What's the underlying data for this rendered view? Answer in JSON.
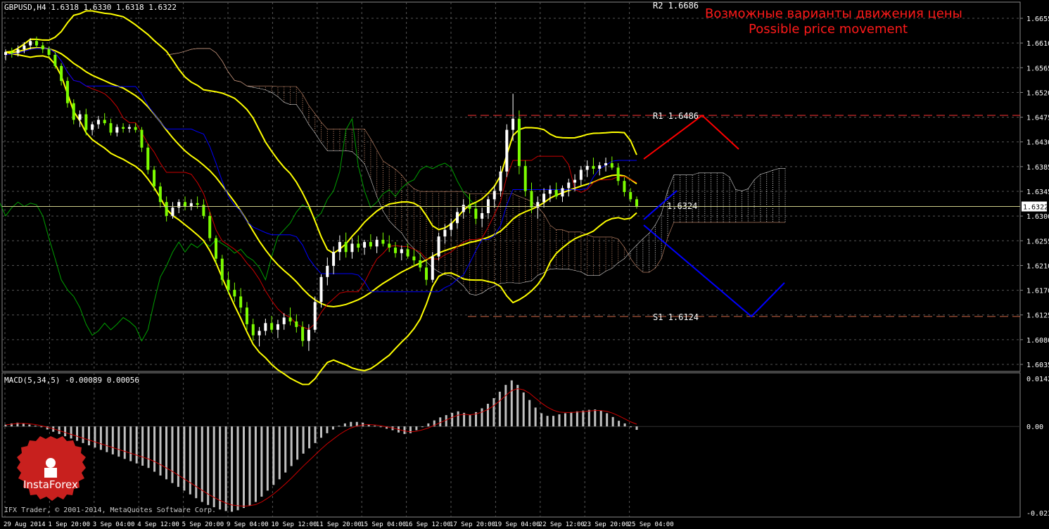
{
  "symbol_header": "GBPUSD,H4  1.6318 1.6330 1.6318 1.6322",
  "annotation_ru": "Возможные варианты движения цены",
  "annotation_en": "Possible price movement",
  "macd_header": "MACD(5,34,5) -0.00089 0.00056",
  "copyright": "IFX Trader, © 2001-2014, MetaQuotes Software Corp.",
  "logo_text": "InstaForex",
  "colors": {
    "bull": "#ffffff",
    "bear": "#7cfc00",
    "bollinger": "#ffff00",
    "tenkan": "#cc0000",
    "kijun": "#0000ff",
    "chikou": "#00a000",
    "kumo": "#ffffff",
    "macd_hist": "#c0c0c0",
    "macd_signal": "#cc0000",
    "resistance": "#ff0000",
    "support": "#0000ff",
    "annotation": "#ff1a1a",
    "grid": "#555555"
  },
  "levels": [
    {
      "name": "R2",
      "value": 1.6686,
      "label": "R2 1.6686"
    },
    {
      "name": "R1",
      "value": 1.6486,
      "label": "R1 1.6486"
    },
    {
      "name": "pivot",
      "value": 1.6324,
      "label": "1.6324"
    },
    {
      "name": "S1",
      "value": 1.6124,
      "label": "S1 1.6124"
    }
  ],
  "current_price": "1.6322",
  "chart_data": [
    {
      "type": "candlestick",
      "title": "GBPUSD,H4",
      "x_ticks": [
        "29 Aug 2014",
        "1 Sep 20:00",
        "3 Sep 04:00",
        "4 Sep 12:00",
        "5 Sep 20:00",
        "9 Sep 04:00",
        "10 Sep 12:00",
        "11 Sep 20:00",
        "15 Sep 04:00",
        "16 Sep 12:00",
        "17 Sep 20:00",
        "19 Sep 04:00",
        "22 Sep 12:00",
        "23 Sep 20:00",
        "25 Sep 04:00"
      ],
      "y_ticks": [
        "1.6655",
        "1.6610",
        "1.6565",
        "1.6520",
        "1.6475",
        "1.6430",
        "1.6385",
        "1.6345",
        "1.6300",
        "1.6255",
        "1.6210",
        "1.6170",
        "1.6125",
        "1.6080",
        "1.6035"
      ],
      "ylim": [
        1.6025,
        1.669
      ],
      "candles": [
        [
          1.6595,
          1.6605,
          1.6585,
          1.66
        ],
        [
          1.66,
          1.6608,
          1.659,
          1.6598
        ],
        [
          1.6598,
          1.6612,
          1.6592,
          1.6605
        ],
        [
          1.6605,
          1.6618,
          1.6598,
          1.6612
        ],
        [
          1.6612,
          1.6625,
          1.6605,
          1.662
        ],
        [
          1.662,
          1.6628,
          1.6608,
          1.6612
        ],
        [
          1.6612,
          1.6618,
          1.6598,
          1.6605
        ],
        [
          1.6605,
          1.661,
          1.659,
          1.6595
        ],
        [
          1.6595,
          1.66,
          1.657,
          1.6575
        ],
        [
          1.6575,
          1.658,
          1.654,
          1.6548
        ],
        [
          1.6548,
          1.6555,
          1.65,
          1.6508
        ],
        [
          1.6508,
          1.6515,
          1.647,
          1.6478
        ],
        [
          1.6478,
          1.6495,
          1.6465,
          1.6488
        ],
        [
          1.6488,
          1.6498,
          1.645,
          1.646
        ],
        [
          1.646,
          1.6475,
          1.645,
          1.647
        ],
        [
          1.647,
          1.6485,
          1.6462,
          1.6478
        ],
        [
          1.6478,
          1.649,
          1.6468,
          1.6472
        ],
        [
          1.6472,
          1.648,
          1.645,
          1.6455
        ],
        [
          1.6455,
          1.647,
          1.6448,
          1.6465
        ],
        [
          1.6465,
          1.6472,
          1.6455,
          1.6462
        ],
        [
          1.6462,
          1.647,
          1.6455,
          1.6465
        ],
        [
          1.6465,
          1.6472,
          1.6455,
          1.646
        ],
        [
          1.646,
          1.6465,
          1.642,
          1.6428
        ],
        [
          1.6428,
          1.6435,
          1.638,
          1.6388
        ],
        [
          1.6388,
          1.6395,
          1.635,
          1.6358
        ],
        [
          1.6358,
          1.6365,
          1.632,
          1.633
        ],
        [
          1.633,
          1.634,
          1.6295,
          1.6305
        ],
        [
          1.6305,
          1.633,
          1.63,
          1.632
        ],
        [
          1.632,
          1.6335,
          1.631,
          1.633
        ],
        [
          1.633,
          1.634,
          1.6315,
          1.6322
        ],
        [
          1.6322,
          1.6335,
          1.6315,
          1.6328
        ],
        [
          1.6328,
          1.634,
          1.6318,
          1.6325
        ],
        [
          1.6325,
          1.6335,
          1.63,
          1.6305
        ],
        [
          1.6305,
          1.6312,
          1.626,
          1.6265
        ],
        [
          1.6265,
          1.627,
          1.622,
          1.6228
        ],
        [
          1.6228,
          1.6235,
          1.618,
          1.619
        ],
        [
          1.619,
          1.6205,
          1.6165,
          1.6172
        ],
        [
          1.6172,
          1.6185,
          1.615,
          1.616
        ],
        [
          1.616,
          1.6175,
          1.613,
          1.614
        ],
        [
          1.614,
          1.615,
          1.61,
          1.611
        ],
        [
          1.611,
          1.612,
          1.608,
          1.609
        ],
        [
          1.609,
          1.6105,
          1.607,
          1.6098
        ],
        [
          1.6098,
          1.612,
          1.609,
          1.6112
        ],
        [
          1.6112,
          1.6125,
          1.6095,
          1.61
        ],
        [
          1.61,
          1.6118,
          1.6085,
          1.611
        ],
        [
          1.611,
          1.613,
          1.61,
          1.6122
        ],
        [
          1.6122,
          1.614,
          1.6108,
          1.6115
        ],
        [
          1.6115,
          1.6128,
          1.6095,
          1.6105
        ],
        [
          1.6105,
          1.6115,
          1.607,
          1.608
        ],
        [
          1.608,
          1.611,
          1.6062,
          1.61
        ],
        [
          1.61,
          1.616,
          1.6095,
          1.615
        ],
        [
          1.615,
          1.62,
          1.614,
          1.6195
        ],
        [
          1.6195,
          1.623,
          1.618,
          1.6215
        ],
        [
          1.6215,
          1.625,
          1.62,
          1.624
        ],
        [
          1.624,
          1.627,
          1.6225,
          1.6258
        ],
        [
          1.6258,
          1.6275,
          1.623,
          1.624
        ],
        [
          1.624,
          1.6265,
          1.6228,
          1.6255
        ],
        [
          1.6255,
          1.627,
          1.624,
          1.6248
        ],
        [
          1.6248,
          1.6262,
          1.6235,
          1.6258
        ],
        [
          1.6258,
          1.6272,
          1.6245,
          1.625
        ],
        [
          1.625,
          1.6268,
          1.6238,
          1.6262
        ],
        [
          1.6262,
          1.6275,
          1.625,
          1.6255
        ],
        [
          1.6255,
          1.627,
          1.624,
          1.6248
        ],
        [
          1.6248,
          1.6258,
          1.623,
          1.6238
        ],
        [
          1.6238,
          1.6252,
          1.6225,
          1.6245
        ],
        [
          1.6245,
          1.6255,
          1.6228,
          1.6232
        ],
        [
          1.6232,
          1.6245,
          1.6215,
          1.6225
        ],
        [
          1.6225,
          1.6238,
          1.6205,
          1.6212
        ],
        [
          1.6212,
          1.6225,
          1.618,
          1.619
        ],
        [
          1.619,
          1.624,
          1.6185,
          1.6232
        ],
        [
          1.6232,
          1.6275,
          1.6225,
          1.6268
        ],
        [
          1.6268,
          1.629,
          1.6255,
          1.628
        ],
        [
          1.628,
          1.63,
          1.6268,
          1.6292
        ],
        [
          1.6292,
          1.632,
          1.6282,
          1.6312
        ],
        [
          1.6312,
          1.6335,
          1.63,
          1.6325
        ],
        [
          1.6325,
          1.6345,
          1.631,
          1.6318
        ],
        [
          1.6318,
          1.633,
          1.629,
          1.63
        ],
        [
          1.63,
          1.632,
          1.6285,
          1.631
        ],
        [
          1.631,
          1.634,
          1.63,
          1.6335
        ],
        [
          1.6335,
          1.636,
          1.632,
          1.635
        ],
        [
          1.635,
          1.6395,
          1.634,
          1.6385
        ],
        [
          1.6385,
          1.647,
          1.6375,
          1.646
        ],
        [
          1.646,
          1.6525,
          1.644,
          1.648
        ],
        [
          1.648,
          1.6495,
          1.638,
          1.6395
        ],
        [
          1.6395,
          1.6405,
          1.634,
          1.635
        ],
        [
          1.635,
          1.6365,
          1.631,
          1.632
        ],
        [
          1.632,
          1.634,
          1.63,
          1.633
        ],
        [
          1.633,
          1.6355,
          1.632,
          1.6345
        ],
        [
          1.6345,
          1.636,
          1.633,
          1.6352
        ],
        [
          1.6352,
          1.6365,
          1.6335,
          1.634
        ],
        [
          1.634,
          1.636,
          1.633,
          1.6355
        ],
        [
          1.6355,
          1.6372,
          1.634,
          1.6365
        ],
        [
          1.6365,
          1.638,
          1.635,
          1.637
        ],
        [
          1.637,
          1.6395,
          1.636,
          1.6388
        ],
        [
          1.6388,
          1.6405,
          1.6375,
          1.6395
        ],
        [
          1.6395,
          1.641,
          1.638,
          1.639
        ],
        [
          1.639,
          1.6402,
          1.6378,
          1.6396
        ],
        [
          1.6396,
          1.641,
          1.6385,
          1.64
        ],
        [
          1.64,
          1.6412,
          1.6388,
          1.6392
        ],
        [
          1.6392,
          1.64,
          1.636,
          1.6368
        ],
        [
          1.6368,
          1.6375,
          1.634,
          1.6348
        ],
        [
          1.6348,
          1.6355,
          1.633,
          1.6335
        ],
        [
          1.6335,
          1.634,
          1.6318,
          1.6322
        ]
      ]
    },
    {
      "type": "bar",
      "title": "MACD(5,34,5)",
      "y_ticks": [
        "0.0142",
        "0.00",
        "-0.0232"
      ],
      "ylim": [
        -0.024,
        0.0142
      ],
      "values": [
        0.0005,
        0.0008,
        0.001,
        0.0008,
        0.0005,
        0.0002,
        -0.0002,
        -0.0008,
        -0.0014,
        -0.002,
        -0.0026,
        -0.0032,
        -0.0038,
        -0.0044,
        -0.005,
        -0.0056,
        -0.0062,
        -0.0068,
        -0.0074,
        -0.008,
        -0.0086,
        -0.0092,
        -0.0098,
        -0.0104,
        -0.011,
        -0.012,
        -0.013,
        -0.014,
        -0.015,
        -0.016,
        -0.017,
        -0.018,
        -0.019,
        -0.02,
        -0.0208,
        -0.0214,
        -0.022,
        -0.0224,
        -0.0226,
        -0.0222,
        -0.0216,
        -0.021,
        -0.02,
        -0.0186,
        -0.017,
        -0.0155,
        -0.014,
        -0.0122,
        -0.0105,
        -0.0088,
        -0.0072,
        -0.0058,
        -0.0044,
        -0.003,
        -0.0018,
        -0.0008,
        0.0002,
        0.0008,
        0.0012,
        0.0012,
        0.001,
        0.0006,
        0.0002,
        -0.0002,
        -0.0006,
        -0.001,
        -0.0016,
        -0.002,
        -0.0018,
        -0.001,
        0.0,
        0.0008,
        0.0016,
        0.0024,
        0.003,
        0.0036,
        0.004,
        0.0036,
        0.003,
        0.0038,
        0.0048,
        0.006,
        0.0075,
        0.0092,
        0.011,
        0.0122,
        0.011,
        0.009,
        0.007,
        0.005,
        0.0035,
        0.0028,
        0.0028,
        0.0032,
        0.0035,
        0.0038,
        0.004,
        0.0042,
        0.0044,
        0.0045,
        0.0042,
        0.0035,
        0.0025,
        0.0015,
        0.0008,
        -0.0002,
        -0.0009
      ],
      "signal": [
        0.0004,
        0.0006,
        0.0008,
        0.0008,
        0.0007,
        0.0005,
        0.0002,
        -0.0002,
        -0.0006,
        -0.0011,
        -0.0016,
        -0.0021,
        -0.0026,
        -0.0031,
        -0.0036,
        -0.0041,
        -0.0046,
        -0.0051,
        -0.0056,
        -0.0061,
        -0.0066,
        -0.0071,
        -0.0076,
        -0.0081,
        -0.0086,
        -0.0093,
        -0.0101,
        -0.011,
        -0.0119,
        -0.0129,
        -0.0139,
        -0.0149,
        -0.0159,
        -0.0169,
        -0.0179,
        -0.0188,
        -0.0196,
        -0.0203,
        -0.0208,
        -0.021,
        -0.0211,
        -0.021,
        -0.0207,
        -0.02,
        -0.019,
        -0.0179,
        -0.0166,
        -0.0152,
        -0.0137,
        -0.0121,
        -0.0105,
        -0.009,
        -0.0075,
        -0.006,
        -0.0046,
        -0.0034,
        -0.0022,
        -0.0012,
        -0.0004,
        0.0001,
        0.0004,
        0.0005,
        0.0004,
        0.0002,
        -0.0001,
        -0.0004,
        -0.0008,
        -0.0012,
        -0.0014,
        -0.0013,
        -0.0009,
        -0.0004,
        0.0003,
        0.001,
        0.0017,
        0.0024,
        0.003,
        0.0032,
        0.0031,
        0.0033,
        0.0038,
        0.0045,
        0.0055,
        0.0068,
        0.0082,
        0.0095,
        0.01,
        0.0097,
        0.0088,
        0.0075,
        0.0062,
        0.0051,
        0.0043,
        0.0038,
        0.0037,
        0.0037,
        0.0038,
        0.0039,
        0.0041,
        0.0042,
        0.0042,
        0.004,
        0.0035,
        0.0028,
        0.002,
        0.0012,
        0.0006
      ]
    }
  ]
}
